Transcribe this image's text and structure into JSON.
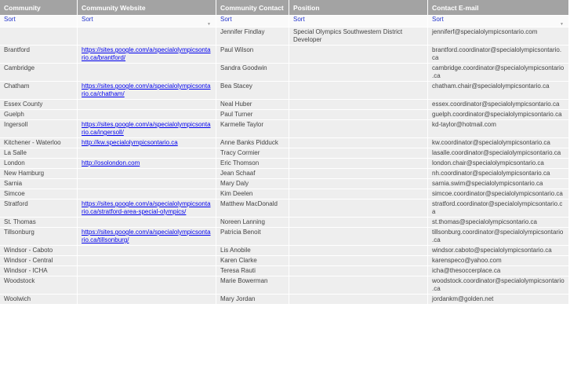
{
  "headers": [
    "Community",
    "Community Website",
    "Community Contact",
    "Position",
    "Contact E-mail"
  ],
  "sort_label": "Sort",
  "rows": [
    {
      "community": "",
      "website": "",
      "contact": "Jennifer Findlay",
      "position": "Special Olympics Southwestern District Developer",
      "email": "jenniferf@specialolympicsontario.com"
    },
    {
      "community": "Brantford",
      "website": "https://sites.google.com/a/specialolympicsontario.ca/brantford/",
      "contact": "Paul Wilson",
      "position": "",
      "email": "brantford.coordinator@specialolympicsontario.ca"
    },
    {
      "community": "Cambridge",
      "website": "",
      "contact": "Sandra Goodwin",
      "position": "",
      "email": "cambridge.coordinator@specialolympicsontario.ca"
    },
    {
      "community": "Chatham",
      "website": "https://sites.google.com/a/specialolympicsontario.ca/chatham/",
      "contact": "Bea Stacey",
      "position": "",
      "email": "chatham.chair@specialolympicsontario.ca"
    },
    {
      "community": "Essex County",
      "website": "",
      "contact": "Neal Huber",
      "position": "",
      "email": "essex.coordinator@specialolympicsontario.ca"
    },
    {
      "community": "Guelph",
      "website": "",
      "contact": "Paul Turner",
      "position": "",
      "email": "guelph.coordinator@specialolympicsontario.ca"
    },
    {
      "community": "Ingersoll",
      "website": "https://sites.google.com/a/specialolympicsontario.ca/ingersoll/",
      "contact": "Karmelle Taylor",
      "position": "",
      "email": "kd-taylor@hotmail.com"
    },
    {
      "community": "Kitchener - Waterloo",
      "website": "http://kw.specialolympicsontario.ca",
      "contact": "Anne Banks Pidduck",
      "position": "",
      "email": "kw.coordinator@specialolympicsontario.ca"
    },
    {
      "community": "La Salle",
      "website": "",
      "contact": "Tracy Cormier",
      "position": "",
      "email": "lasalle.coordinator@specialolympicsontario.ca"
    },
    {
      "community": "London",
      "website": "http://osolondon.com",
      "contact": "Eric Thomson",
      "position": "",
      "email": "london.chair@specialolympicsontario.ca"
    },
    {
      "community": "New Hamburg",
      "website": "",
      "contact": "Jean Schaaf",
      "position": "",
      "email": "nh.coordinator@specialolympicsontario.ca"
    },
    {
      "community": "Sarnia",
      "website": "",
      "contact": "Mary Daly",
      "position": "",
      "email": "sarnia.swim@specialolympicsontario.ca"
    },
    {
      "community": "Simcoe",
      "website": "",
      "contact": "Kim Deelen",
      "position": "",
      "email": "simcoe.coordinator@specialolympicsontario.ca"
    },
    {
      "community": "Stratford",
      "website": "https://sites.google.com/a/specialolympicsontario.ca/stratford-area-special-olympics/",
      "contact": "Matthew MacDonald",
      "position": "",
      "email": "stratford.coordinator@specialolympicsontario.ca"
    },
    {
      "community": "St. Thomas",
      "website": "",
      "contact": "Noreen Lanning",
      "position": "",
      "email": "st.thomas@specialolympicsontario.ca"
    },
    {
      "community": "Tillsonburg",
      "website": "https://sites.google.com/a/specialolympicsontario.ca/tillsonburg/",
      "contact": "Patricia Benoit",
      "position": "",
      "email": "tillsonburg.coordinator@specialolympicsontario.ca"
    },
    {
      "community": "Windsor - Caboto",
      "website": "",
      "contact": "Lis Anobile",
      "position": "",
      "email": "windsor.caboto@specialolympicsontario.ca"
    },
    {
      "community": "Windsor - Central",
      "website": "",
      "contact": "Karen Clarke",
      "position": "",
      "email": "karenspeco@yahoo.com"
    },
    {
      "community": "Windsor - ICHA",
      "website": "",
      "contact": "Teresa Rauti",
      "position": "",
      "email": "icha@thesoccerplace.ca"
    },
    {
      "community": "Woodstock",
      "website": "",
      "contact": "Marie Bowerman",
      "position": "",
      "email": "woodstock.coordinator@specialolympicsontario.ca"
    },
    {
      "community": "Woolwich",
      "website": "",
      "contact": "Mary Jordan",
      "position": "",
      "email": "jordankm@golden.net"
    }
  ]
}
